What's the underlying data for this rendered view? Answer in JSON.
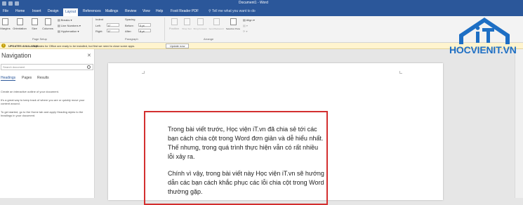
{
  "window": {
    "title": "Document1 - Word"
  },
  "tabs": [
    "File",
    "Home",
    "Insert",
    "Design",
    "Layout",
    "References",
    "Mailings",
    "Review",
    "View",
    "Help",
    "Foxit Reader PDF"
  ],
  "active_tab": "Layout",
  "tell_me": "Tell me what you want to do",
  "ribbon": {
    "buttons": [
      "Margins",
      "Orientation",
      "Size",
      "Columns"
    ],
    "breaks": "Breaks",
    "line_numbers": "Line Numbers",
    "hyphenation": "Hyphenation",
    "indent_label": "Indent",
    "spacing_label": "Spacing",
    "left_label": "Left:",
    "left_value": "0\"",
    "right_label": "Right:",
    "right_value": "0\"",
    "before_label": "Before:",
    "before_value": "0 pt",
    "after_label": "After:",
    "after_value": "8 pt",
    "arrange_buttons": [
      "Position",
      "Wrap Text",
      "Bring Forward",
      "Send Backward",
      "Selection Pane"
    ],
    "align": "Align",
    "group_page_setup": "Page Setup",
    "group_paragraph": "Paragraph",
    "group_arrange": "Arrange"
  },
  "message_bar": {
    "label": "UPDATES AVAILABLE",
    "text": "Updates for Office are ready to be installed, but first we need to close some apps.",
    "button": "Update now"
  },
  "navigation": {
    "title": "Navigation",
    "search_placeholder": "Search document",
    "tabs": [
      "Headings",
      "Pages",
      "Results"
    ],
    "text1": "Create an interactive outline of your document.",
    "text2": "It's a great way to keep track of where you are or quickly move your content around.",
    "text3": "To get started, go to the Home tab and apply Heading styles to the headings in your document."
  },
  "document": {
    "paragraph1": "Trong bài viết trước, Học viện iT.vn đã chia sẻ tới các bạn cách chia cột trong Word đơn giản và dễ hiểu nhất. Thế nhưng, trong quá trình thực hiện vẫn có rất nhiều lỗi xảy ra.",
    "paragraph2": "Chính vì vậy, trong bài viết này Học viện iT.vn sẽ hướng dẫn các bạn cách khắc phục các lỗi chia cột trong Word thường gặp."
  },
  "watermark": {
    "text": "HOCVIENIT.VN"
  },
  "colors": {
    "accent": "#2b579a",
    "highlight": "#d32f2f",
    "logo": "#1e6fc4"
  }
}
